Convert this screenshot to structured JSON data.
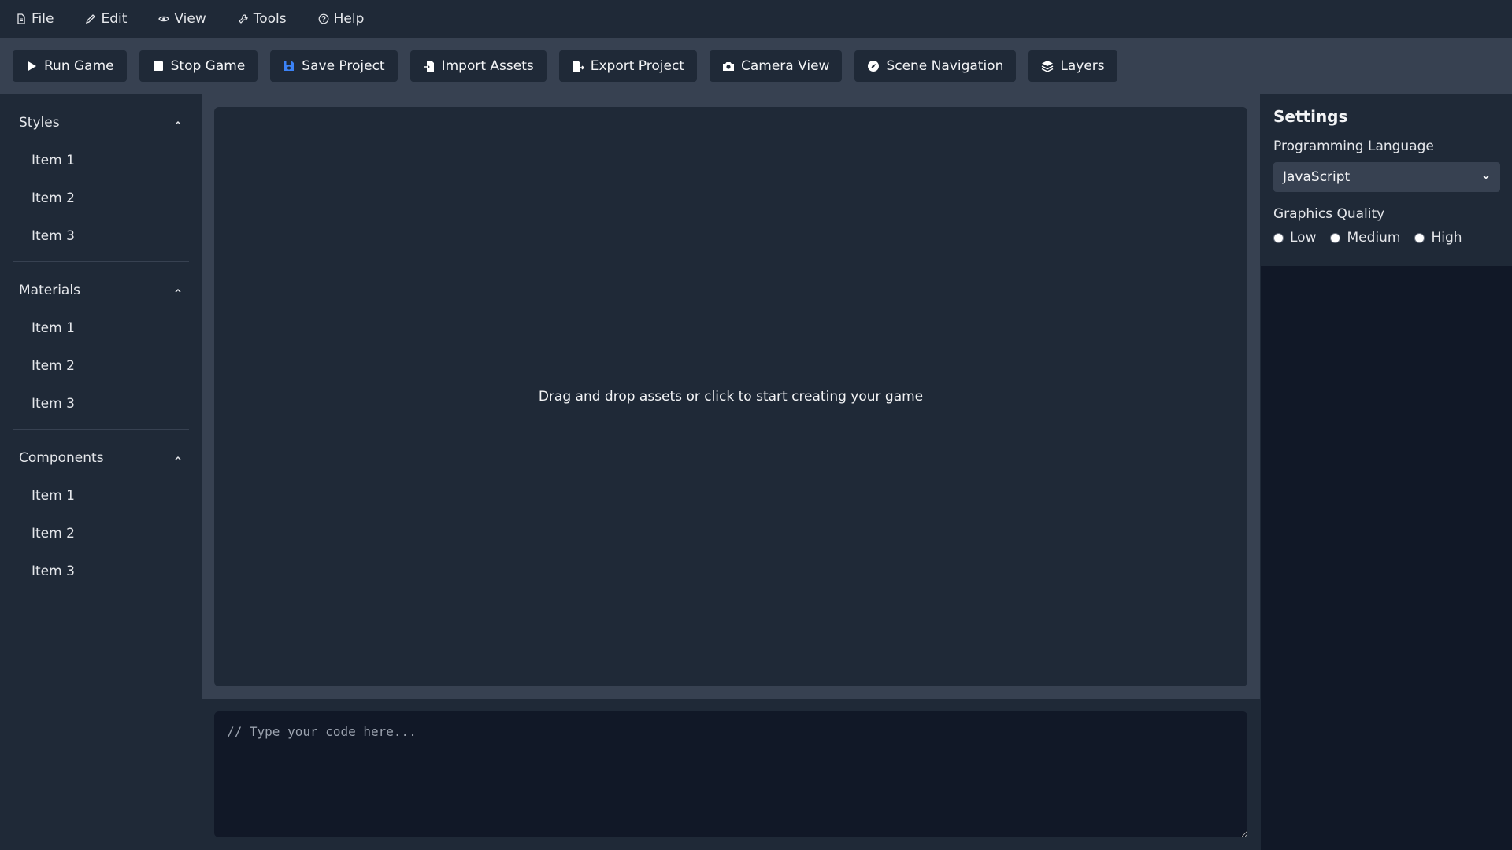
{
  "menu": {
    "items": [
      {
        "label": "File",
        "icon": "file-icon"
      },
      {
        "label": "Edit",
        "icon": "pencil-icon"
      },
      {
        "label": "View",
        "icon": "eye-icon"
      },
      {
        "label": "Tools",
        "icon": "wrench-icon"
      },
      {
        "label": "Help",
        "icon": "help-circle-icon"
      }
    ]
  },
  "toolbar": {
    "buttons": [
      {
        "label": "Run Game",
        "icon": "play-icon"
      },
      {
        "label": "Stop Game",
        "icon": "stop-icon"
      },
      {
        "label": "Save Project",
        "icon": "save-icon"
      },
      {
        "label": "Import Assets",
        "icon": "import-icon"
      },
      {
        "label": "Export Project",
        "icon": "export-icon"
      },
      {
        "label": "Camera View",
        "icon": "camera-icon"
      },
      {
        "label": "Scene Navigation",
        "icon": "compass-icon"
      },
      {
        "label": "Layers",
        "icon": "layers-icon"
      }
    ],
    "save_icon_color": "#3b82f6"
  },
  "sidebar": {
    "groups": [
      {
        "title": "Styles",
        "items": [
          "Item 1",
          "Item 2",
          "Item 3"
        ]
      },
      {
        "title": "Materials",
        "items": [
          "Item 1",
          "Item 2",
          "Item 3"
        ]
      },
      {
        "title": "Components",
        "items": [
          "Item 1",
          "Item 2",
          "Item 3"
        ]
      }
    ]
  },
  "canvas": {
    "prompt": "Drag and drop assets or click to start creating your game"
  },
  "code_editor": {
    "placeholder": "// Type your code here..."
  },
  "settings": {
    "title": "Settings",
    "language_label": "Programming Language",
    "language_value": "JavaScript",
    "quality_label": "Graphics Quality",
    "quality_options": [
      "Low",
      "Medium",
      "High"
    ]
  }
}
